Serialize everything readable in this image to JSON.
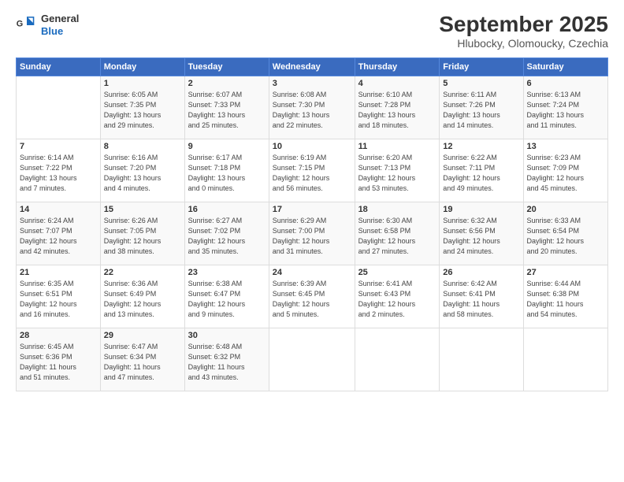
{
  "header": {
    "logo": {
      "general": "General",
      "blue": "Blue"
    },
    "title": "September 2025",
    "location": "Hlubocky, Olomoucky, Czechia"
  },
  "days_header": [
    "Sunday",
    "Monday",
    "Tuesday",
    "Wednesday",
    "Thursday",
    "Friday",
    "Saturday"
  ],
  "weeks": [
    [
      {
        "day": "",
        "info": ""
      },
      {
        "day": "1",
        "info": "Sunrise: 6:05 AM\nSunset: 7:35 PM\nDaylight: 13 hours\nand 29 minutes."
      },
      {
        "day": "2",
        "info": "Sunrise: 6:07 AM\nSunset: 7:33 PM\nDaylight: 13 hours\nand 25 minutes."
      },
      {
        "day": "3",
        "info": "Sunrise: 6:08 AM\nSunset: 7:30 PM\nDaylight: 13 hours\nand 22 minutes."
      },
      {
        "day": "4",
        "info": "Sunrise: 6:10 AM\nSunset: 7:28 PM\nDaylight: 13 hours\nand 18 minutes."
      },
      {
        "day": "5",
        "info": "Sunrise: 6:11 AM\nSunset: 7:26 PM\nDaylight: 13 hours\nand 14 minutes."
      },
      {
        "day": "6",
        "info": "Sunrise: 6:13 AM\nSunset: 7:24 PM\nDaylight: 13 hours\nand 11 minutes."
      }
    ],
    [
      {
        "day": "7",
        "info": "Sunrise: 6:14 AM\nSunset: 7:22 PM\nDaylight: 13 hours\nand 7 minutes."
      },
      {
        "day": "8",
        "info": "Sunrise: 6:16 AM\nSunset: 7:20 PM\nDaylight: 13 hours\nand 4 minutes."
      },
      {
        "day": "9",
        "info": "Sunrise: 6:17 AM\nSunset: 7:18 PM\nDaylight: 13 hours\nand 0 minutes."
      },
      {
        "day": "10",
        "info": "Sunrise: 6:19 AM\nSunset: 7:15 PM\nDaylight: 12 hours\nand 56 minutes."
      },
      {
        "day": "11",
        "info": "Sunrise: 6:20 AM\nSunset: 7:13 PM\nDaylight: 12 hours\nand 53 minutes."
      },
      {
        "day": "12",
        "info": "Sunrise: 6:22 AM\nSunset: 7:11 PM\nDaylight: 12 hours\nand 49 minutes."
      },
      {
        "day": "13",
        "info": "Sunrise: 6:23 AM\nSunset: 7:09 PM\nDaylight: 12 hours\nand 45 minutes."
      }
    ],
    [
      {
        "day": "14",
        "info": "Sunrise: 6:24 AM\nSunset: 7:07 PM\nDaylight: 12 hours\nand 42 minutes."
      },
      {
        "day": "15",
        "info": "Sunrise: 6:26 AM\nSunset: 7:05 PM\nDaylight: 12 hours\nand 38 minutes."
      },
      {
        "day": "16",
        "info": "Sunrise: 6:27 AM\nSunset: 7:02 PM\nDaylight: 12 hours\nand 35 minutes."
      },
      {
        "day": "17",
        "info": "Sunrise: 6:29 AM\nSunset: 7:00 PM\nDaylight: 12 hours\nand 31 minutes."
      },
      {
        "day": "18",
        "info": "Sunrise: 6:30 AM\nSunset: 6:58 PM\nDaylight: 12 hours\nand 27 minutes."
      },
      {
        "day": "19",
        "info": "Sunrise: 6:32 AM\nSunset: 6:56 PM\nDaylight: 12 hours\nand 24 minutes."
      },
      {
        "day": "20",
        "info": "Sunrise: 6:33 AM\nSunset: 6:54 PM\nDaylight: 12 hours\nand 20 minutes."
      }
    ],
    [
      {
        "day": "21",
        "info": "Sunrise: 6:35 AM\nSunset: 6:51 PM\nDaylight: 12 hours\nand 16 minutes."
      },
      {
        "day": "22",
        "info": "Sunrise: 6:36 AM\nSunset: 6:49 PM\nDaylight: 12 hours\nand 13 minutes."
      },
      {
        "day": "23",
        "info": "Sunrise: 6:38 AM\nSunset: 6:47 PM\nDaylight: 12 hours\nand 9 minutes."
      },
      {
        "day": "24",
        "info": "Sunrise: 6:39 AM\nSunset: 6:45 PM\nDaylight: 12 hours\nand 5 minutes."
      },
      {
        "day": "25",
        "info": "Sunrise: 6:41 AM\nSunset: 6:43 PM\nDaylight: 12 hours\nand 2 minutes."
      },
      {
        "day": "26",
        "info": "Sunrise: 6:42 AM\nSunset: 6:41 PM\nDaylight: 11 hours\nand 58 minutes."
      },
      {
        "day": "27",
        "info": "Sunrise: 6:44 AM\nSunset: 6:38 PM\nDaylight: 11 hours\nand 54 minutes."
      }
    ],
    [
      {
        "day": "28",
        "info": "Sunrise: 6:45 AM\nSunset: 6:36 PM\nDaylight: 11 hours\nand 51 minutes."
      },
      {
        "day": "29",
        "info": "Sunrise: 6:47 AM\nSunset: 6:34 PM\nDaylight: 11 hours\nand 47 minutes."
      },
      {
        "day": "30",
        "info": "Sunrise: 6:48 AM\nSunset: 6:32 PM\nDaylight: 11 hours\nand 43 minutes."
      },
      {
        "day": "",
        "info": ""
      },
      {
        "day": "",
        "info": ""
      },
      {
        "day": "",
        "info": ""
      },
      {
        "day": "",
        "info": ""
      }
    ]
  ]
}
